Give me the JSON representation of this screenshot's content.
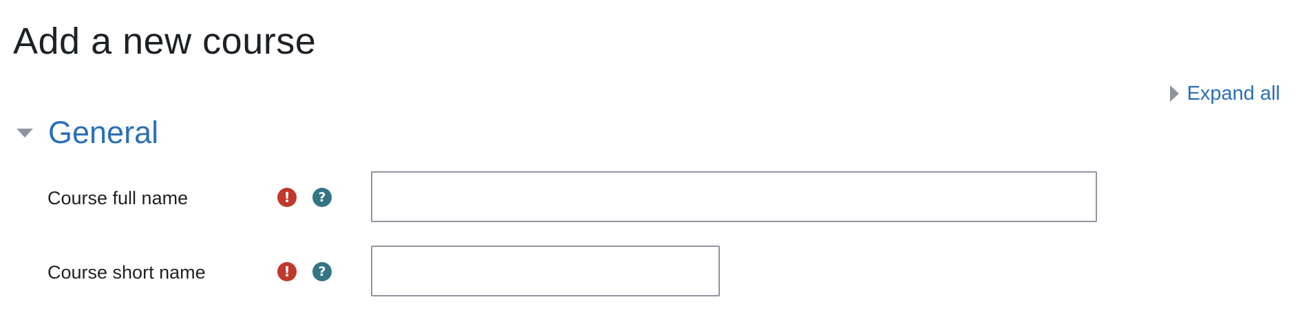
{
  "page": {
    "title": "Add a new course"
  },
  "controls": {
    "expand_all_label": "Expand all"
  },
  "section": {
    "title": "General",
    "fields": [
      {
        "label": "Course full name",
        "value": "",
        "required": true,
        "help": true
      },
      {
        "label": "Course short name",
        "value": "",
        "required": true,
        "help": true
      }
    ]
  },
  "icons": {
    "required": "exclamation-circle-icon",
    "help": "question-circle-icon",
    "expand": "caret-right-icon",
    "collapse": "caret-down-icon"
  },
  "colors": {
    "link": "#2a6fb8",
    "required": "#c0392b",
    "help": "#347584",
    "caret": "#8f959e"
  }
}
